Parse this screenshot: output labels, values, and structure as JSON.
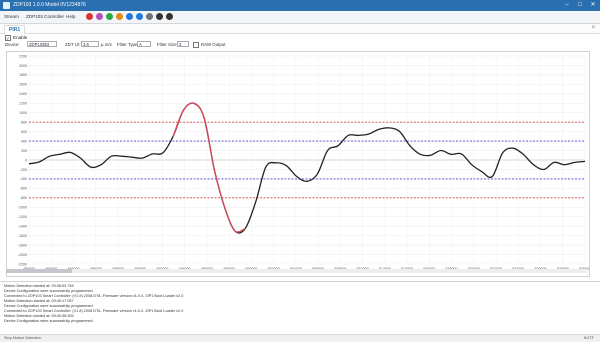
{
  "window": {
    "title": "ZDP103 1.0.0 Model 0V1234876"
  },
  "toolbar": {
    "menus": [
      "Stream",
      "ZDP103 Controller",
      "Help"
    ],
    "tool_colors": [
      "#d7372f",
      "#b64db8",
      "#28a745",
      "#e28b1a",
      "#1f7ae0",
      "#1f7ae0",
      "#6c757d",
      "#333333",
      "#333333"
    ]
  },
  "tab": {
    "label": "PIR1"
  },
  "enable": {
    "label": "Enable",
    "checked": true
  },
  "params": {
    "device_label": "Device:",
    "device_value": "ZDP103tbt",
    "setting_label": "ZDT UI:",
    "setting_value": "3.6",
    "setting_unit": "µ m/s",
    "filter_type_label": "Filter Type:",
    "filter_type_value": "A",
    "filter_size_label": "Filter Size:",
    "filter_size_value": "3",
    "raw_label": "RAW Output"
  },
  "chart_data": {
    "type": "line",
    "ylim": [
      -2200,
      2200
    ],
    "yticks": [
      -2200,
      -2000,
      -1800,
      -1600,
      -1400,
      -1200,
      -1000,
      -800,
      -600,
      -400,
      -200,
      0,
      200,
      400,
      600,
      800,
      1000,
      1200,
      1400,
      1600,
      1800,
      2000,
      2200
    ],
    "xlim": [
      0,
      54
    ],
    "xticks_labels": [
      "480000",
      "482000",
      "484000",
      "486000",
      "488000",
      "490000",
      "492000",
      "494000",
      "496000",
      "498000",
      "500000",
      "502000",
      "504000",
      "506000",
      "508000",
      "510000",
      "512000",
      "514000",
      "516000",
      "518000",
      "520000",
      "522000",
      "524000",
      "526000",
      "528000",
      "530000"
    ],
    "thresholds": [
      {
        "value": 800,
        "color": "#d94848"
      },
      {
        "value": 400,
        "color": "#4a4ad8"
      },
      {
        "value": -400,
        "color": "#4a4ad8"
      },
      {
        "value": -800,
        "color": "#d94848"
      }
    ],
    "series": [
      {
        "color": "#222222",
        "x": [
          0,
          1,
          2,
          3,
          4,
          5,
          6,
          7,
          8,
          9,
          10,
          11,
          12,
          13,
          14,
          15,
          16,
          17,
          18,
          19,
          20,
          21,
          22,
          23,
          24,
          25,
          26,
          27,
          28,
          29,
          30,
          31,
          32,
          33,
          34,
          35,
          36,
          37,
          38,
          39,
          40,
          41,
          42,
          43,
          44,
          45,
          46,
          47,
          48,
          49,
          50,
          51,
          52,
          53,
          54
        ],
        "y": [
          -80,
          -40,
          80,
          120,
          160,
          40,
          -150,
          -100,
          80,
          80,
          60,
          40,
          130,
          150,
          500,
          1050,
          1200,
          900,
          -200,
          -1000,
          -1500,
          -1450,
          -900,
          -150,
          -60,
          -120,
          -350,
          -450,
          -300,
          200,
          300,
          520,
          520,
          550,
          650,
          680,
          600,
          300,
          120,
          100,
          200,
          120,
          130,
          -100,
          -250,
          -350,
          150,
          250,
          120,
          -100,
          -200,
          -50,
          -100,
          -50,
          -30
        ]
      },
      {
        "color": "#d24a5a",
        "from": 14,
        "to": 21
      }
    ]
  },
  "log": {
    "lines": [
      "Motion Detection started at: 09:36:53.745",
      "Device Configuration were successfully programmed",
      "Connected to ZDP103 Smart Controller: (V1.8) 2008 DTA, Firmware version v1.0.0, ZIP1 Boot Loader v2.0",
      "Motion Detection started at: 09:40:17.057",
      "Device Configuration were successfully programmed",
      "Connected to ZDP103 Smart Controller: (V1.8) 2008 DTA, Firmware version v1.0.0, ZIP1 Boot Loader v2.0",
      "Motion Detection started at: 09:40:36.905",
      "Device Configuration were successfully programmed"
    ]
  },
  "status": {
    "left": "Stop Motion Detection",
    "right": "NOTF"
  }
}
